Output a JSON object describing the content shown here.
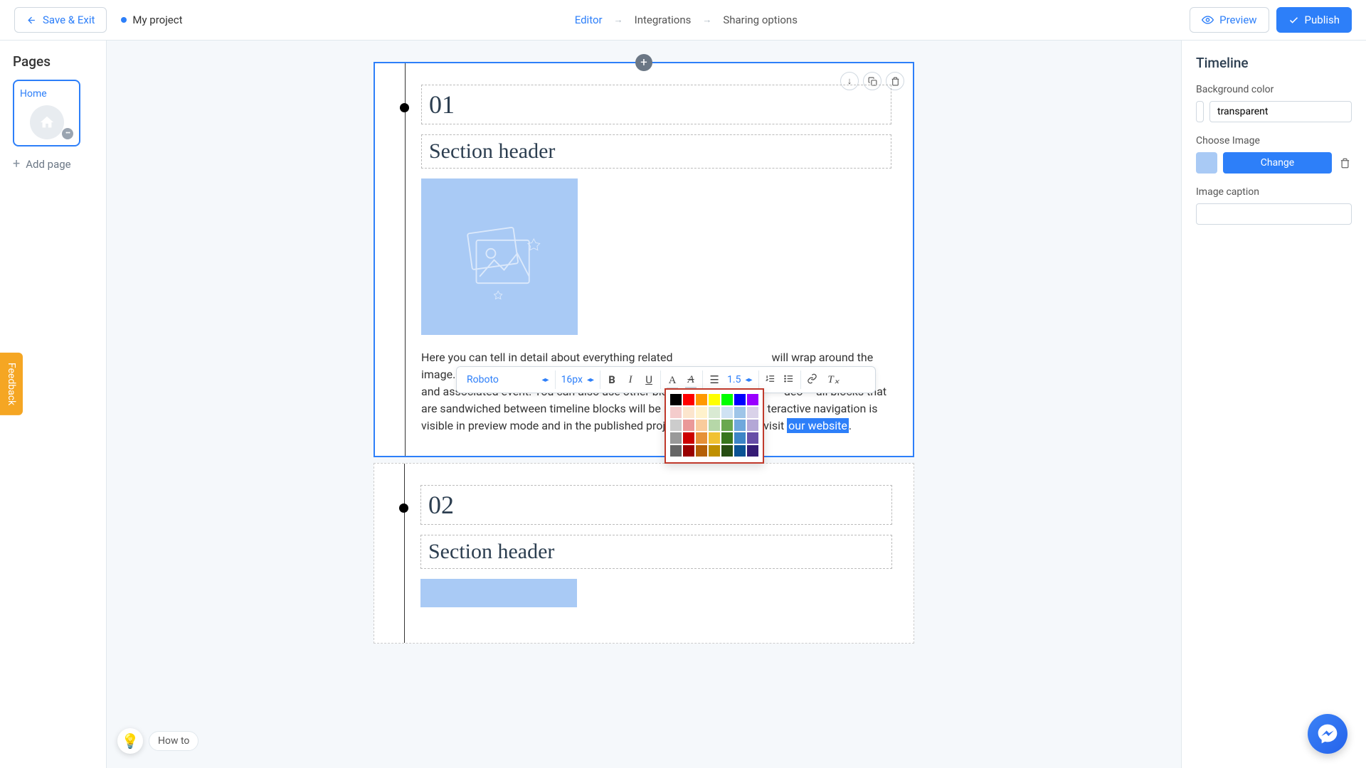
{
  "topbar": {
    "save_label": "Save & Exit",
    "project_name": "My project",
    "nav": [
      "Editor",
      "Integrations",
      "Sharing options"
    ],
    "active_nav": 0,
    "preview_label": "Preview",
    "publish_label": "Publish"
  },
  "sidebar_left": {
    "title": "Pages",
    "page_label": "Home",
    "add_page": "Add page"
  },
  "timeline": {
    "items": [
      {
        "num": "01",
        "header": "Section header",
        "body_before": "Here you can tell in detail about everything related",
        "body_after": "will wrap around the image. You can see how it looks in preview mode. You can",
        "body_mid": "dd a new date and associated event. You can also use other blocks, s",
        "body_mid2": "deo – all blocks that are sandwiched between timeline blocks will be merged",
        "body_end": "teractive navigation is visible in preview mode and in the published project. To know more, visit ",
        "link": "our website",
        "period": "."
      },
      {
        "num": "02",
        "header": "Section header"
      }
    ]
  },
  "rte": {
    "font": "Roboto",
    "size": "16px",
    "line_height": "1.5"
  },
  "color_palette": {
    "rows": [
      [
        "#000000",
        "#ff0000",
        "#ff9900",
        "#ffff00",
        "#00ff00",
        "#0000ff",
        "#9900ff"
      ],
      [
        "#f4cccc",
        "#fce5cd",
        "#fff2cc",
        "#d9ead3",
        "#cfe2f3",
        "#9fc5e8",
        "#d9d2e9"
      ],
      [
        "#cccccc",
        "#ea9999",
        "#f9cb9c",
        "#b6d7a8",
        "#6aa84f",
        "#6fa8dc",
        "#b4a7d6"
      ],
      [
        "#999999",
        "#cc0000",
        "#e69138",
        "#f1c232",
        "#38761d",
        "#3d85c6",
        "#674ea7"
      ],
      [
        "#666666",
        "#990000",
        "#b45f06",
        "#bf9000",
        "#274e13",
        "#0b5394",
        "#351c75"
      ]
    ]
  },
  "sidebar_right": {
    "title": "Timeline",
    "bg_label": "Background color",
    "bg_value": "transparent",
    "img_label": "Choose Image",
    "change_label": "Change",
    "caption_label": "Image caption"
  },
  "misc": {
    "feedback": "Feedback",
    "howto": "How to"
  }
}
